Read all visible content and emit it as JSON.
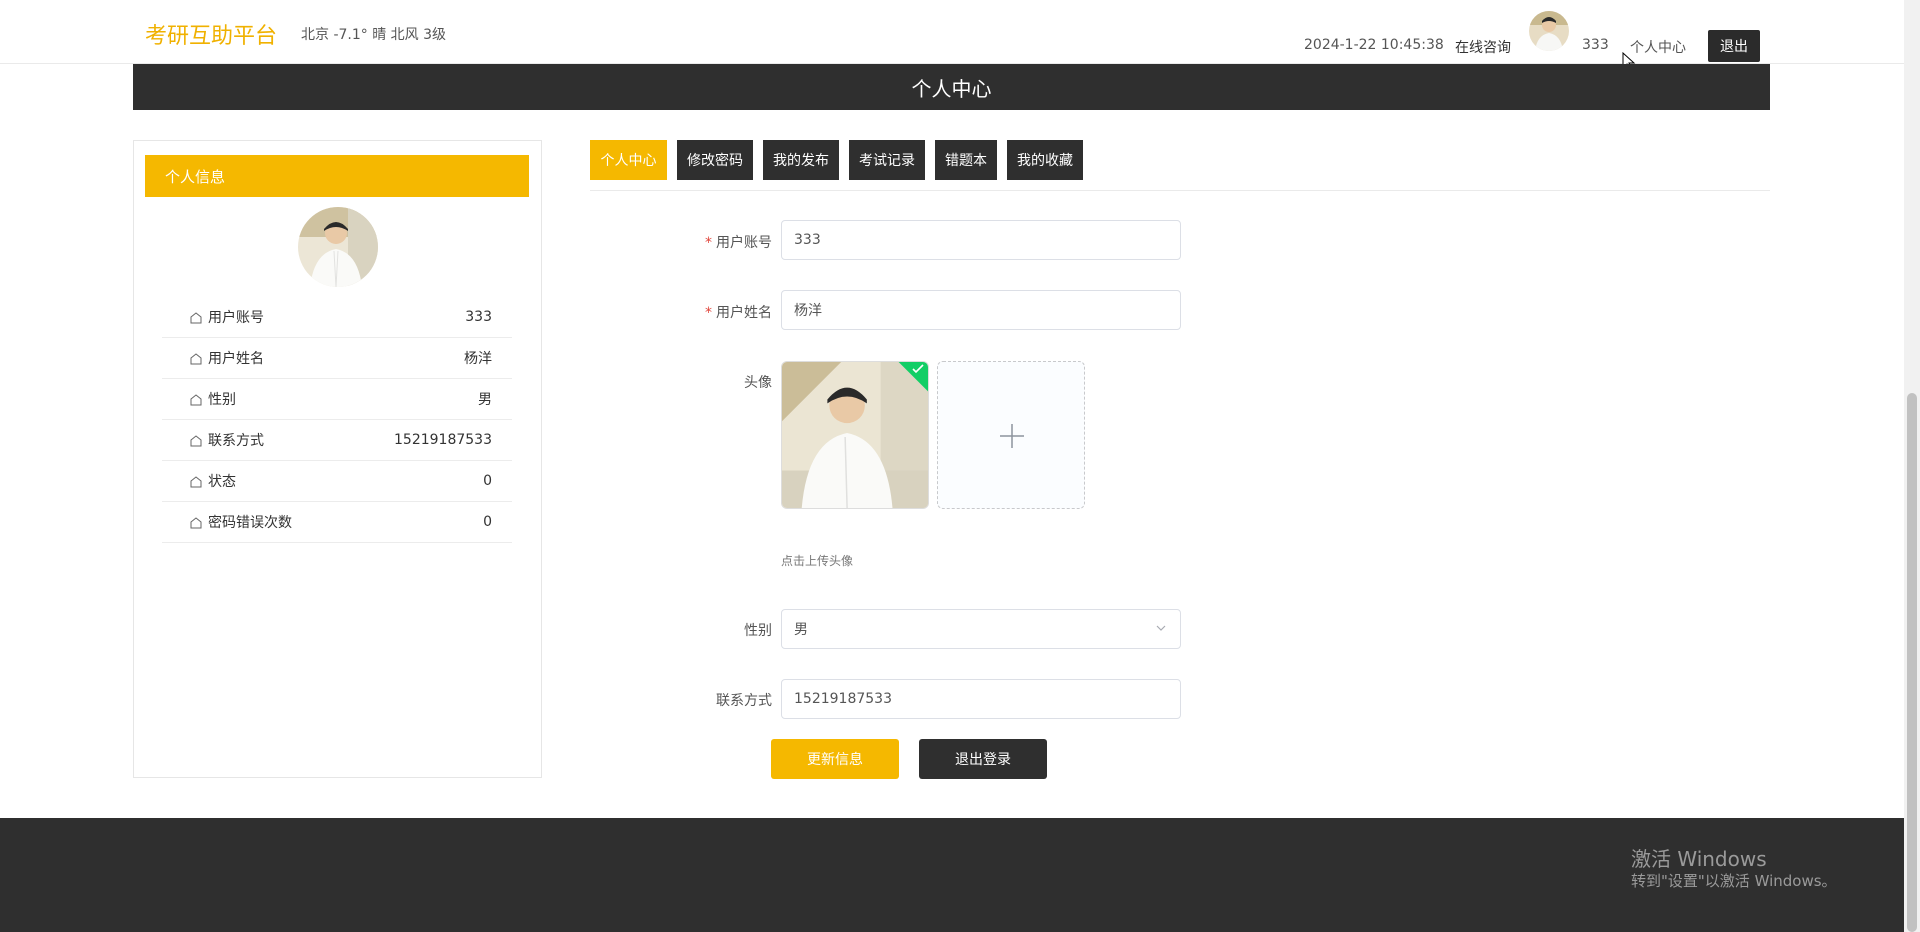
{
  "header": {
    "brand": "考研互助平台",
    "weather": "北京  -7.1°  晴  北风  3级",
    "datetime": "2024-1-22 10:45:38",
    "consult": "在线咨询",
    "username": "333",
    "personal_center": "个人中心",
    "logout": "退出"
  },
  "banner": {
    "title": "个人中心"
  },
  "profile_card": {
    "title": "个人信息",
    "items": [
      {
        "label": "用户账号",
        "value": "333"
      },
      {
        "label": "用户姓名",
        "value": "杨洋"
      },
      {
        "label": "性别",
        "value": "男"
      },
      {
        "label": "联系方式",
        "value": "15219187533"
      },
      {
        "label": "状态",
        "value": "0"
      },
      {
        "label": "密码错误次数",
        "value": "0"
      }
    ]
  },
  "tabs": [
    {
      "label": "个人中心",
      "active": true
    },
    {
      "label": "修改密码",
      "active": false
    },
    {
      "label": "我的发布",
      "active": false
    },
    {
      "label": "考试记录",
      "active": false
    },
    {
      "label": "错题本",
      "active": false
    },
    {
      "label": "我的收藏",
      "active": false
    }
  ],
  "form": {
    "account_label": "用户账号",
    "account_value": "333",
    "name_label": "用户姓名",
    "name_value": "杨洋",
    "avatar_label": "头像",
    "upload_tip": "点击上传头像",
    "gender_label": "性别",
    "gender_value": "男",
    "phone_label": "联系方式",
    "phone_value": "15219187533",
    "required_mark": "*",
    "update_button": "更新信息",
    "logout_button": "退出登录"
  },
  "watermark": {
    "title": "激活 Windows",
    "subtitle": "转到\"设置\"以激活 Windows。"
  },
  "colors": {
    "accent": "#f5b800",
    "dark": "#2f2f2f",
    "brand": "#f0b100",
    "required": "#e0443a",
    "success": "#13ce66"
  },
  "icons": {
    "row_icon": "home-icon",
    "select_icon": "chevron-down-icon",
    "upload_icon": "plus-icon",
    "success_icon": "check-icon"
  }
}
